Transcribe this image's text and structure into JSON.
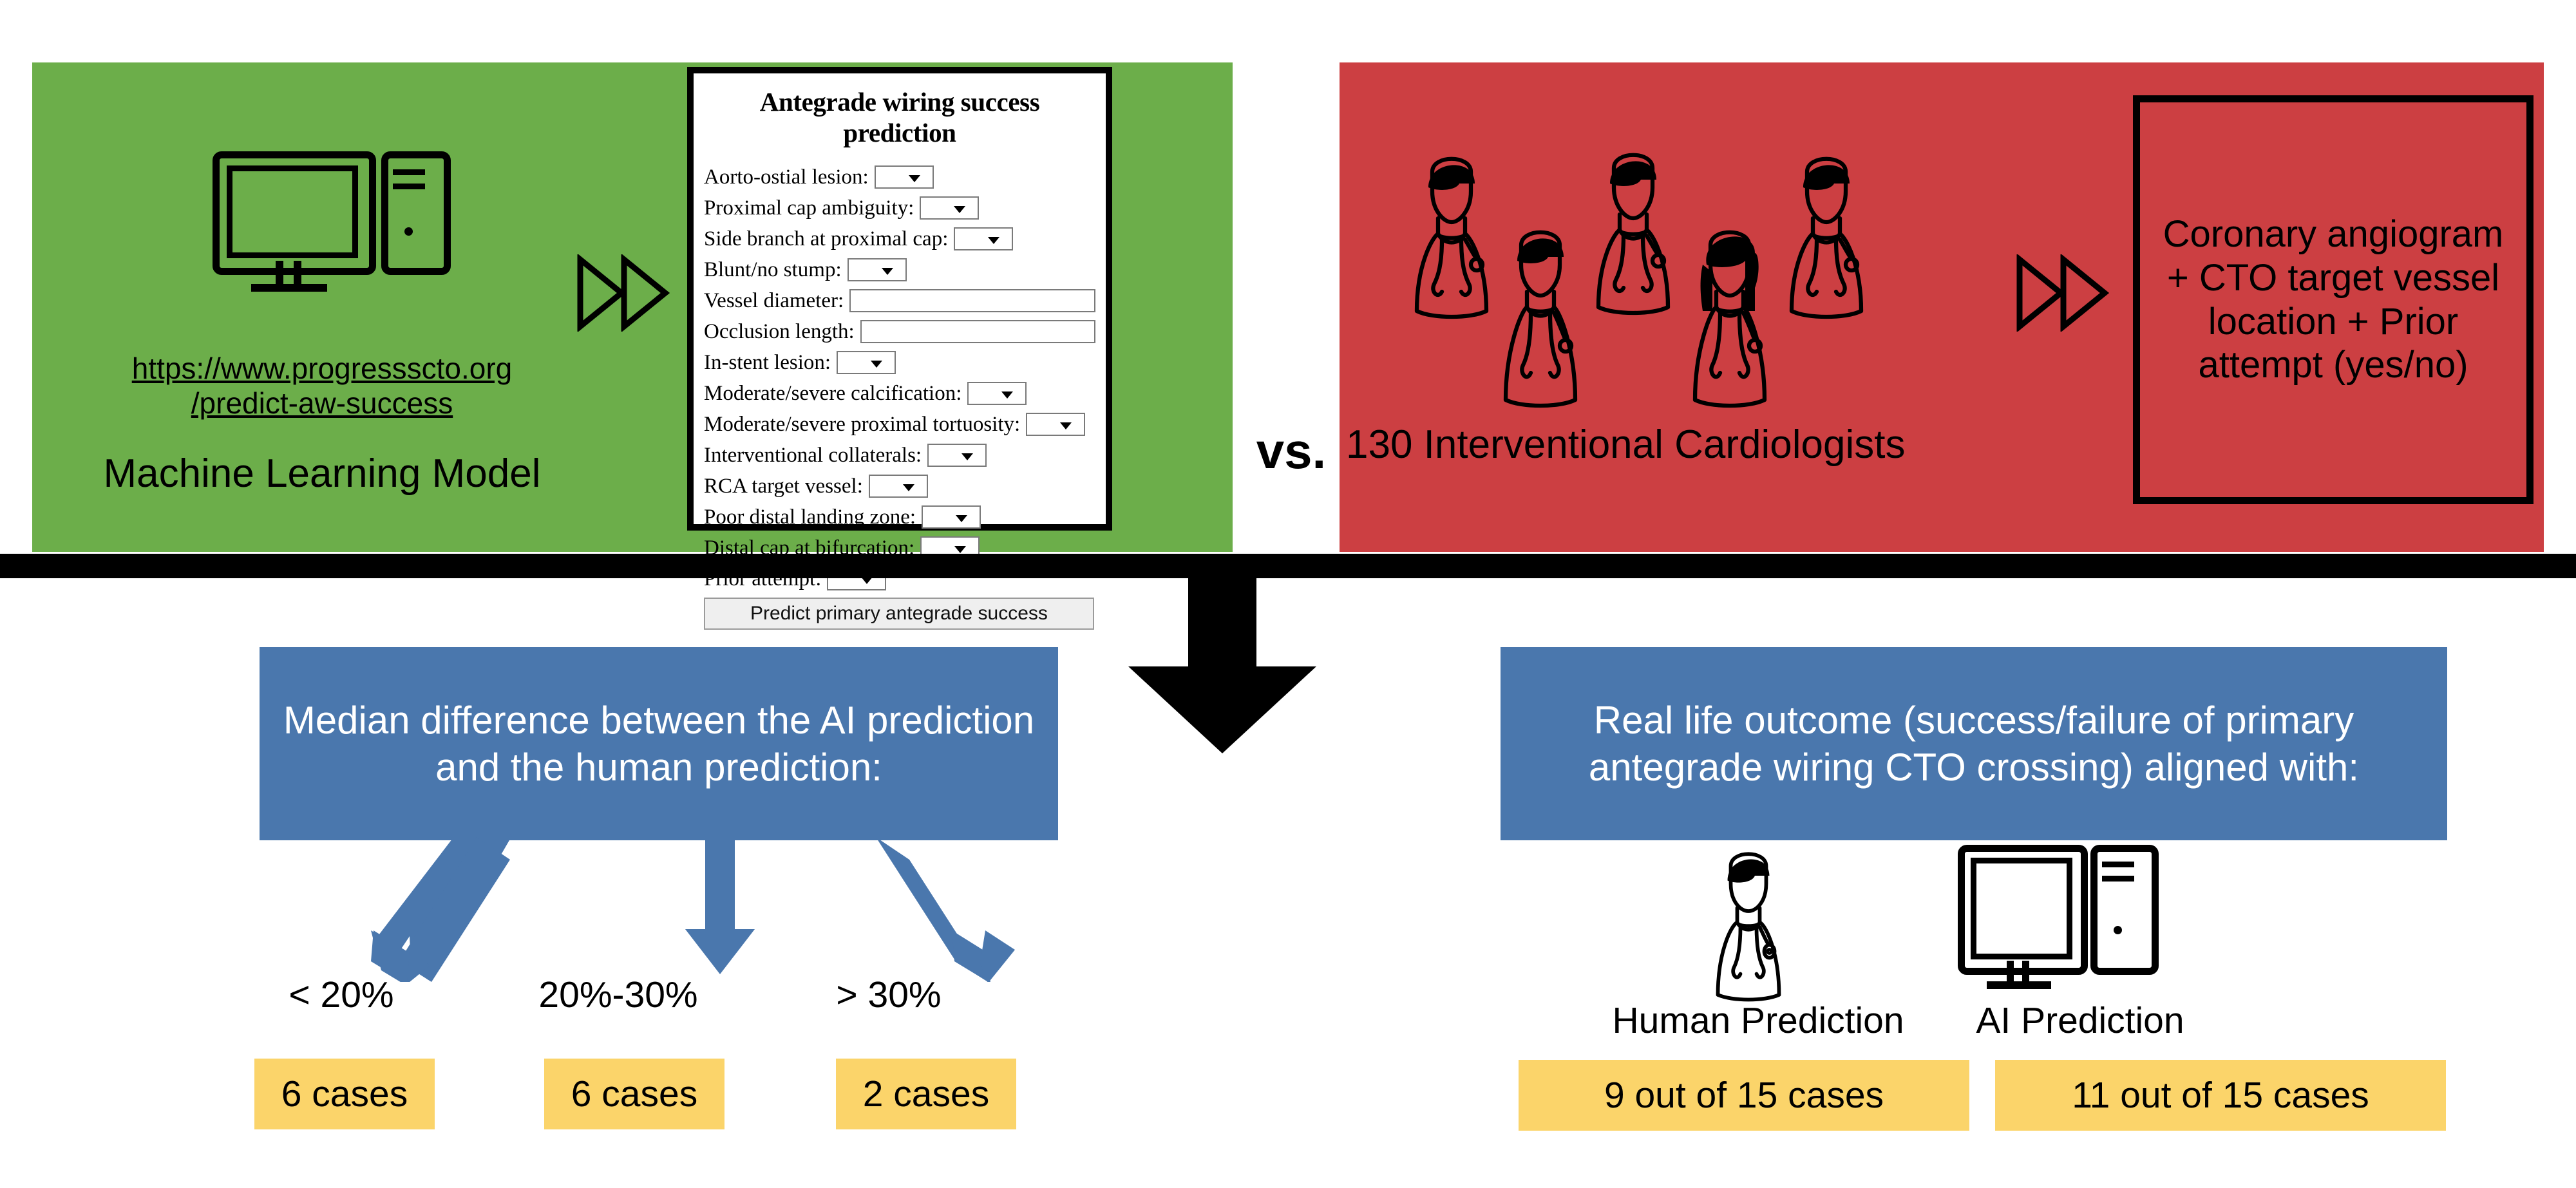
{
  "top": {
    "left_panel": {
      "color": "#6cae4a",
      "computer_icon": "desktop-computer-icon",
      "url": "https://www.progressscto.org/predict-aw-success",
      "url_line1": "https://www.progressscto.org",
      "url_line2": "/predict-aw-success",
      "caption": "Machine Learning Model",
      "chevron_icon": "double-chevron-right-icon",
      "form": {
        "title": "Antegrade wiring success prediction",
        "fields": [
          {
            "label": "Aorto-ostial lesion:",
            "type": "select",
            "value": ""
          },
          {
            "label": "Proximal cap ambiguity:",
            "type": "select",
            "value": ""
          },
          {
            "label": "Side branch at proximal cap:",
            "type": "select",
            "value": ""
          },
          {
            "label": "Blunt/no stump:",
            "type": "select",
            "value": ""
          },
          {
            "label": "Vessel diameter:",
            "type": "text",
            "value": ""
          },
          {
            "label": "Occlusion length:",
            "type": "text",
            "value": ""
          },
          {
            "label": "In-stent lesion:",
            "type": "select",
            "value": ""
          },
          {
            "label": "Moderate/severe calcification:",
            "type": "select",
            "value": ""
          },
          {
            "label": "Moderate/severe proximal tortuosity:",
            "type": "select",
            "value": ""
          },
          {
            "label": "Interventional collaterals:",
            "type": "select",
            "value": ""
          },
          {
            "label": "RCA target vessel:",
            "type": "select",
            "value": ""
          },
          {
            "label": "Poor distal landing zone:",
            "type": "select",
            "value": ""
          },
          {
            "label": "Distal cap at bifurcation:",
            "type": "select",
            "value": ""
          },
          {
            "label": "Prior attempt:",
            "type": "select",
            "value": ""
          }
        ],
        "submit_label": "Predict primary antegrade success"
      }
    },
    "versus_label": "vs.",
    "right_panel": {
      "color": "#cc3f42",
      "doctors_icon": "doctors-group-icon",
      "caption": "130 Interventional Cardiologists",
      "chevron_icon": "double-chevron-right-icon",
      "inputs_box": "Coronary angiogram + CTO target vessel location + Prior attempt (yes/no)"
    }
  },
  "flow_arrow_icon": "down-arrow-icon",
  "bottom": {
    "left": {
      "header": "Median difference between the AI prediction and the human prediction:",
      "header_color": "#4a77ad",
      "arrow_icon": "blue-down-arrow-icon",
      "buckets": [
        {
          "label": "< 20%",
          "cases": "6 cases"
        },
        {
          "label": "20%-30%",
          "cases": "6 cases"
        },
        {
          "label": "> 30%",
          "cases": "2 cases"
        }
      ],
      "badge_color": "#fbd46a"
    },
    "right": {
      "header": "Real life outcome (success/failure of primary antegrade wiring CTO crossing) aligned with:",
      "header_color": "#4a77ad",
      "predictors": [
        {
          "icon": "doctor-icon",
          "label": "Human Prediction",
          "result": "9 out of 15 cases"
        },
        {
          "icon": "desktop-computer-icon",
          "label": "AI Prediction",
          "result": "11 out of 15 cases"
        }
      ],
      "badge_color": "#fbd46a"
    }
  }
}
